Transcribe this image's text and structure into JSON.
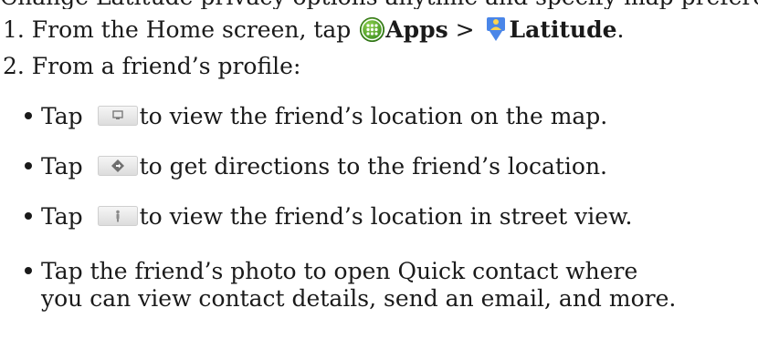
{
  "header_cut": "Change Latitude privacy options anytime and specify map preferences.",
  "step1": {
    "prefix": "1. From the Home screen, tap ",
    "apps_icon": "apps-grid-icon",
    "apps_label": "Apps",
    "separator": " > ",
    "latitude_icon": "latitude-pin-icon",
    "latitude_label": "Latitude",
    "suffix": "."
  },
  "step2": {
    "text": "2.  From a friend’s profile:"
  },
  "bullets": [
    {
      "icon": "map-button-icon",
      "before": "Tap ",
      "after": "to view the friend’s location on the map."
    },
    {
      "icon": "directions-button-icon",
      "before": "Tap ",
      "after": "to get directions to the friend’s location."
    },
    {
      "icon": "street-view-button-icon",
      "before": "Tap ",
      "after": "to view the friend’s location in street view."
    }
  ],
  "bullet4": {
    "line1": "Tap the friend’s photo to open Quick contact where",
    "line2": "you can view contact details, send an email, and more."
  }
}
